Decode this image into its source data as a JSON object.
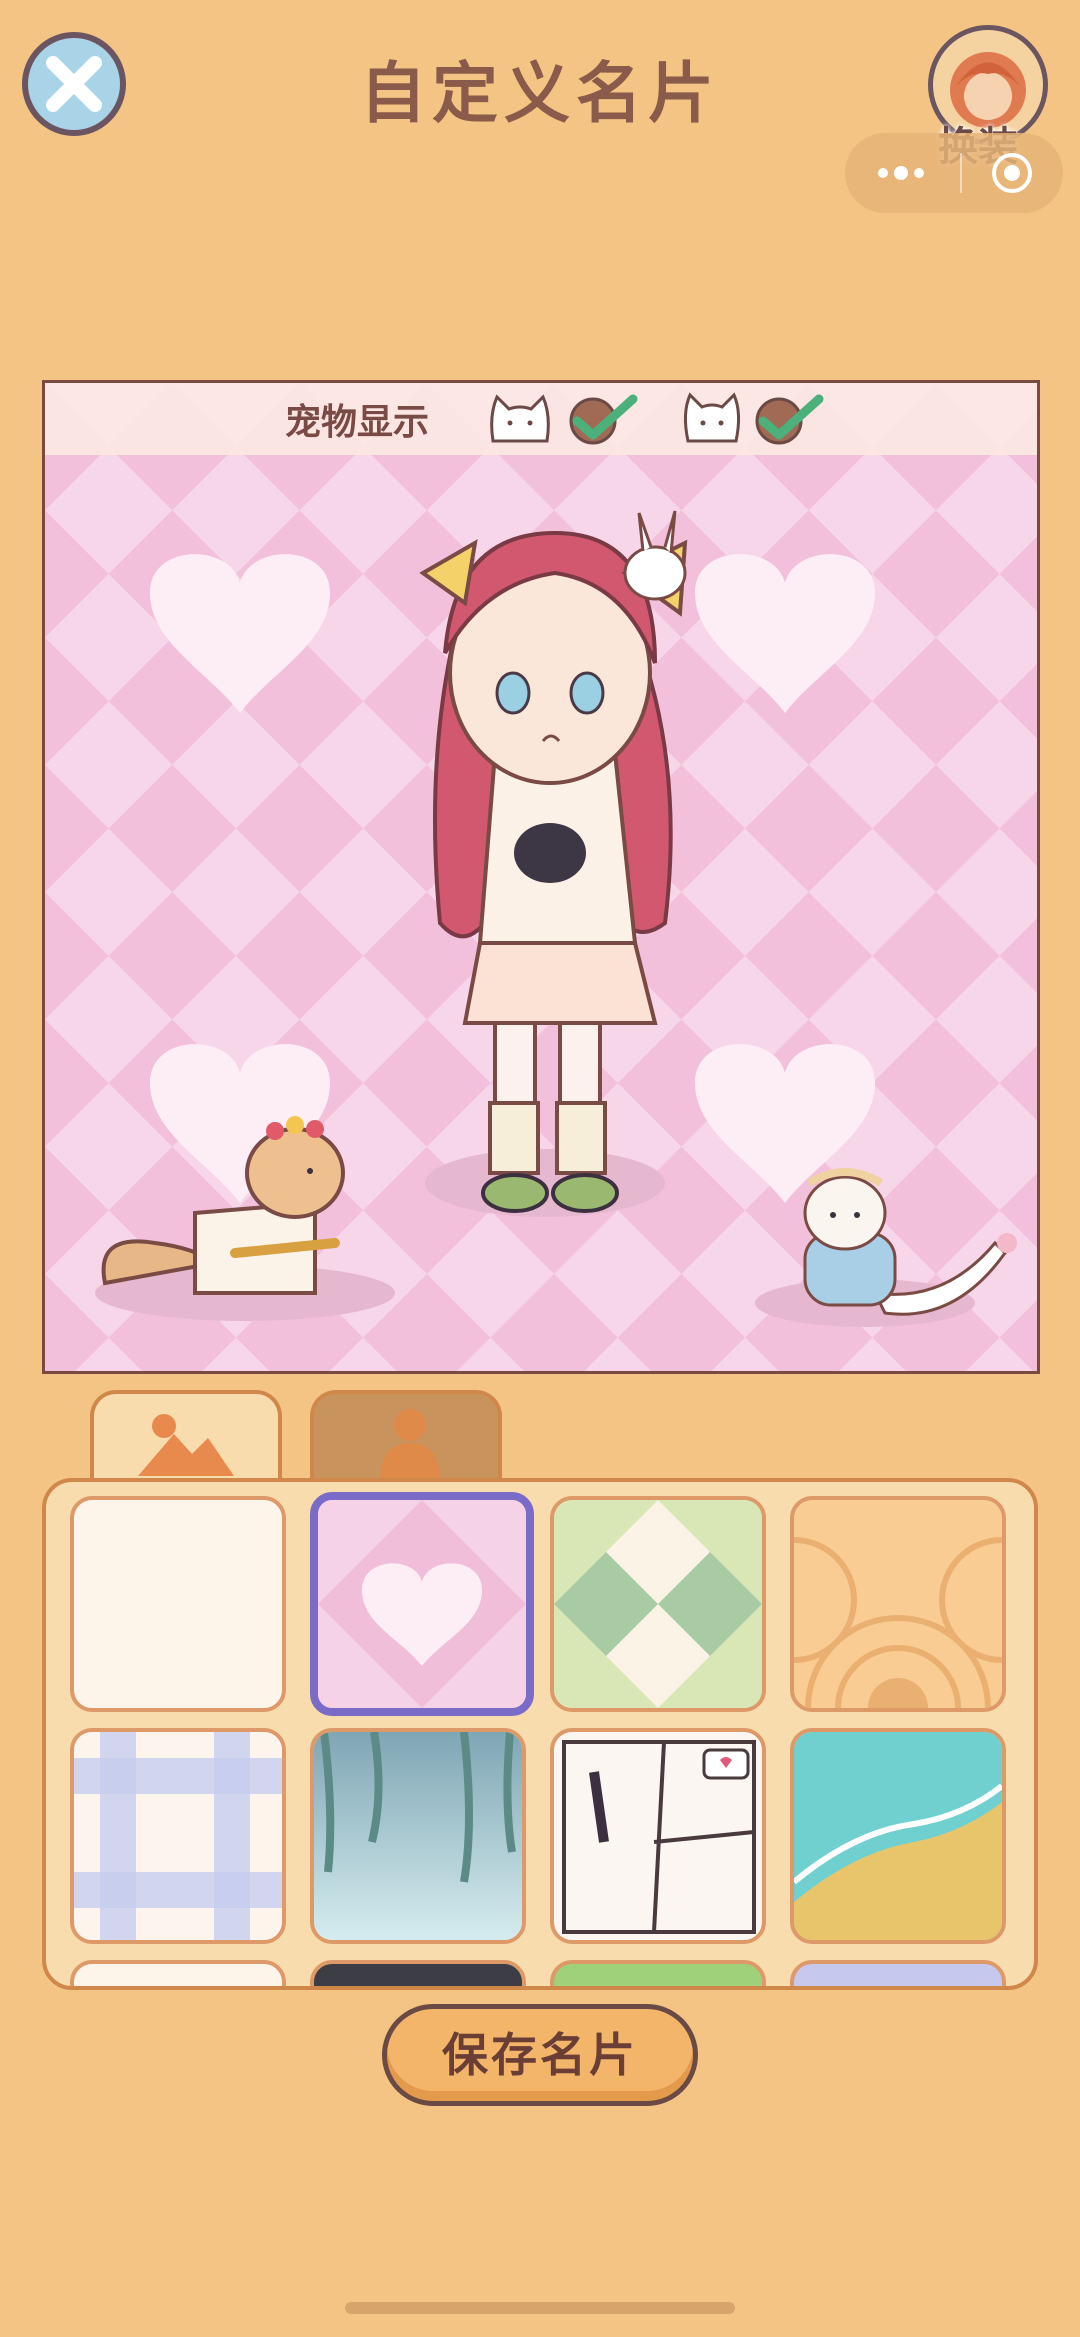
{
  "header": {
    "title": "自定义名片",
    "outfit_label": "换装"
  },
  "card": {
    "pet_display_label": "宠物显示",
    "pets": [
      {
        "icon": "cat-face-icon",
        "checked": true
      },
      {
        "icon": "kitten-face-icon",
        "checked": true
      }
    ]
  },
  "tabs": [
    {
      "icon": "scenery-icon",
      "active": true
    },
    {
      "icon": "character-icon",
      "active": false
    }
  ],
  "backgrounds": [
    {
      "name": "plain-cream",
      "selected": false
    },
    {
      "name": "pink-hearts",
      "selected": true
    },
    {
      "name": "green-checker",
      "selected": false
    },
    {
      "name": "orange-waves",
      "selected": false
    },
    {
      "name": "blue-plaid",
      "selected": false
    },
    {
      "name": "forest-vines",
      "selected": false
    },
    {
      "name": "manga-panels",
      "selected": false
    },
    {
      "name": "beach",
      "selected": false
    }
  ],
  "save_button": "保存名片",
  "colors": {
    "background": "#f3c484",
    "selected_border": "#7a6bc8",
    "check": "#4bb07a"
  }
}
